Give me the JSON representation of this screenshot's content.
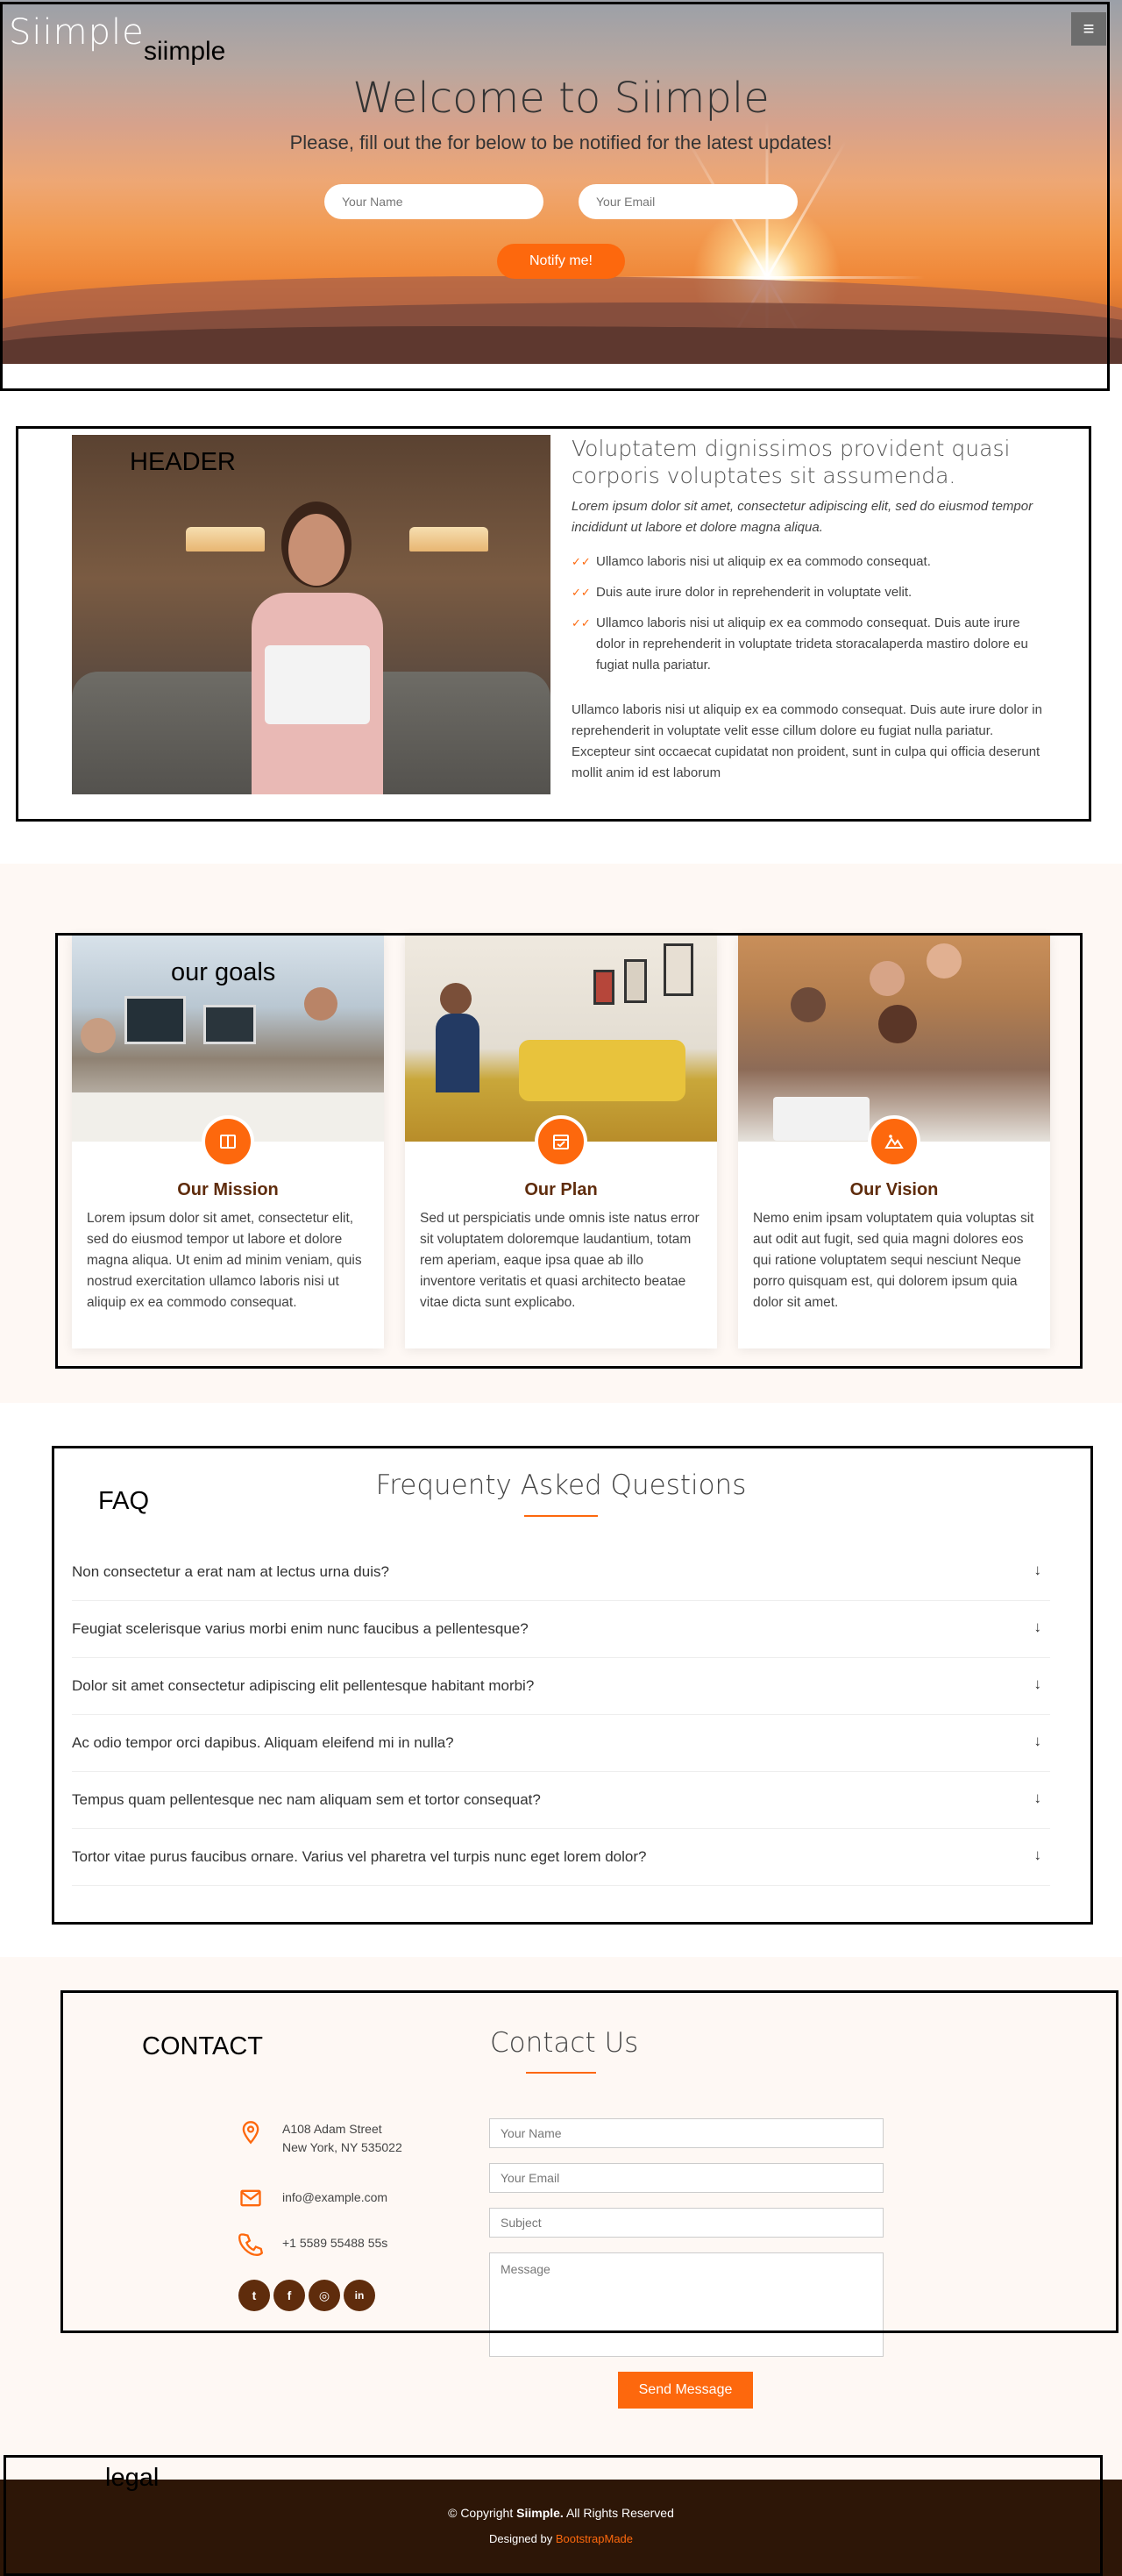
{
  "hero": {
    "logo": "Siimple",
    "title": "Welcome to Siimple",
    "subtitle": "Please, fill out the for below to be notified for the latest updates!",
    "name_placeholder": "Your Name",
    "email_placeholder": "Your Email",
    "notify_label": "Notify me!",
    "menu_icon": "≡"
  },
  "annotations": {
    "hero": "siimple",
    "header": "HEADER",
    "goals": "our goals",
    "faq": "FAQ",
    "contact": "CONTACT",
    "legal": "legal"
  },
  "about": {
    "title": "Voluptatem dignissimos provident quasi corporis voluptates sit assumenda.",
    "intro": "Lorem ipsum dolor sit amet, consectetur adipiscing elit, sed do eiusmod tempor incididunt ut labore et dolore magna aliqua.",
    "items": [
      "Ullamco laboris nisi ut aliquip ex ea commodo consequat.",
      "Duis aute irure dolor in reprehenderit in voluptate velit.",
      "Ullamco laboris nisi ut aliquip ex ea commodo consequat. Duis aute irure dolor in reprehenderit in voluptate trideta storacalaperda mastiro dolore eu fugiat nulla pariatur."
    ],
    "paragraph": "Ullamco laboris nisi ut aliquip ex ea commodo consequat. Duis aute irure dolor in reprehenderit in voluptate velit esse cillum dolore eu fugiat nulla pariatur. Excepteur sint occaecat cupidatat non proident, sunt in culpa qui officia deserunt mollit anim id est laborum"
  },
  "goals": [
    {
      "title": "Our Mission",
      "icon": "book-icon",
      "text": "Lorem ipsum dolor sit amet, consectetur elit, sed do eiusmod tempor ut labore et dolore magna aliqua. Ut enim ad minim veniam, quis nostrud exercitation ullamco laboris nisi ut aliquip ex ea commodo consequat."
    },
    {
      "title": "Our Plan",
      "icon": "calendar-check-icon",
      "text": "Sed ut perspiciatis unde omnis iste natus error sit voluptatem doloremque laudantium, totam rem aperiam, eaque ipsa quae ab illo inventore veritatis et quasi architecto beatae vitae dicta sunt explicabo."
    },
    {
      "title": "Our Vision",
      "icon": "image-icon",
      "text": "Nemo enim ipsam voluptatem quia voluptas sit aut odit aut fugit, sed quia magni dolores eos qui ratione voluptatem sequi nesciunt Neque porro quisquam est, qui dolorem ipsum quia dolor sit amet."
    }
  ],
  "faq": {
    "title": "Frequenty Asked Questions",
    "arrow": "↓",
    "items": [
      "Non consectetur a erat nam at lectus urna duis?",
      "Feugiat scelerisque varius morbi enim nunc faucibus a pellentesque?",
      "Dolor sit amet consectetur adipiscing elit pellentesque habitant morbi?",
      "Ac odio tempor orci dapibus. Aliquam eleifend mi in nulla?",
      "Tempus quam pellentesque nec nam aliquam sem et tortor consequat?",
      "Tortor vitae purus faucibus ornare. Varius vel pharetra vel turpis nunc eget lorem dolor?"
    ]
  },
  "contact": {
    "title": "Contact Us",
    "address_line1": "A108 Adam Street",
    "address_line2": "New York, NY 535022",
    "email": "info@example.com",
    "phone": "+1 5589 55488 55s",
    "social": {
      "twitter": "t",
      "facebook": "f",
      "instagram": "◎",
      "linkedin": "in"
    },
    "form": {
      "name_placeholder": "Your Name",
      "email_placeholder": "Your Email",
      "subject_placeholder": "Subject",
      "message_placeholder": "Message",
      "send_label": "Send Message"
    },
    "accent": "#fd680d"
  },
  "footer": {
    "copy_prefix": "© Copyright",
    "brand": "Siimple.",
    "copy_suffix": "All Rights Reserved",
    "designed_by": "Designed by",
    "designer": "BootstrapMade"
  }
}
